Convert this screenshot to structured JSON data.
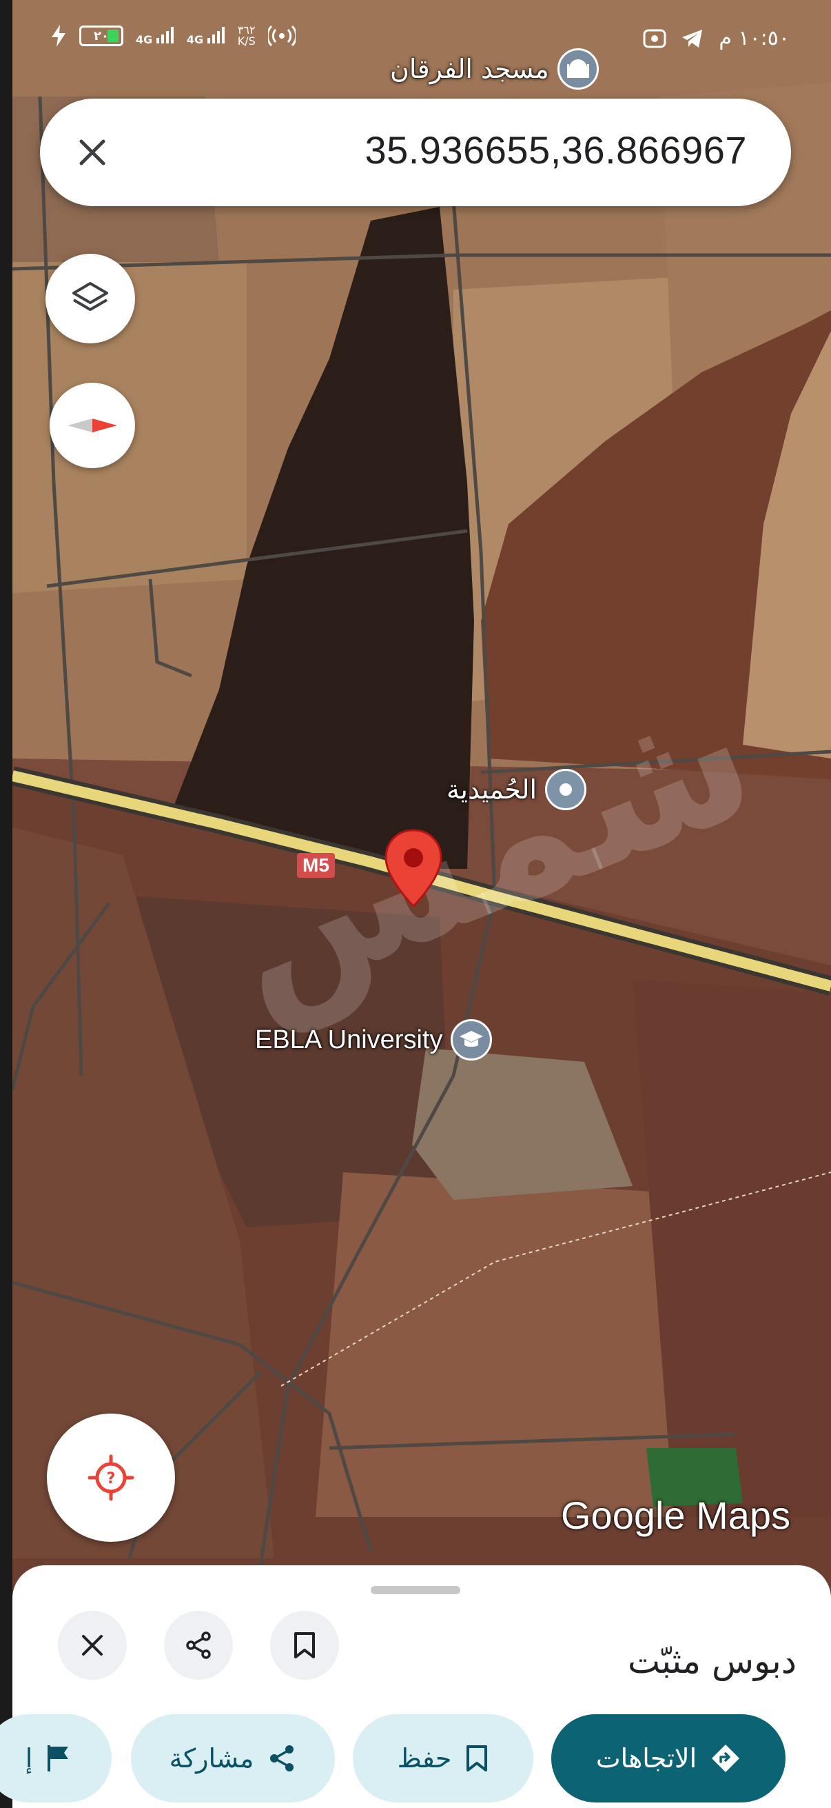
{
  "status_bar": {
    "time": "١٠:٥٠ م",
    "network_speed": "٣٦٢",
    "network_speed_unit": "K/S",
    "signal_1": "4G",
    "signal_2": "4G",
    "battery_level": "٢٠"
  },
  "search": {
    "coordinates": "35.936655,36.866967"
  },
  "map": {
    "labels": {
      "mosque": "مسجد الفرقان",
      "village": "الحُميدية",
      "university": "EBLA University",
      "highway_shield": "M5"
    },
    "attribution": "Google Maps",
    "watermark": "شمس"
  },
  "controls": {
    "layers_icon": "layers-icon",
    "compass_icon": "compass-icon",
    "location_icon": "my-location-icon"
  },
  "sheet": {
    "title": "دبوس مثبّت",
    "actions": {
      "directions": "الاتجاهات",
      "save": "حفظ",
      "share": "مشاركة",
      "label": "إ"
    }
  },
  "colors": {
    "primary": "#0b6374",
    "primary_light": "#d9eff4",
    "pin_red": "#ea4335",
    "highway": "#e8d77a"
  }
}
